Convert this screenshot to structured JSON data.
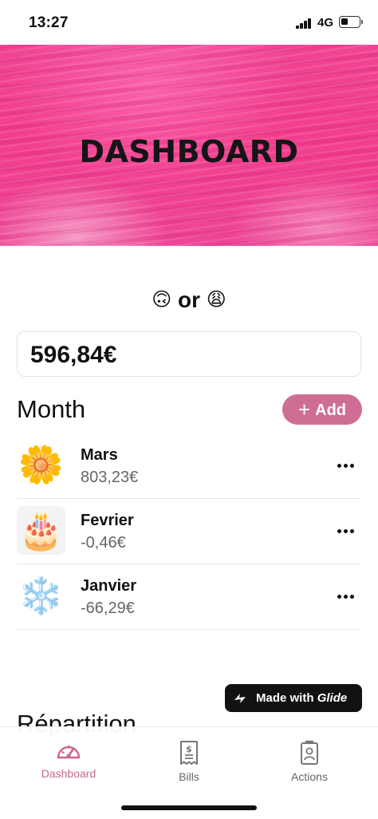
{
  "status_bar": {
    "time": "13:27",
    "network": "4G",
    "battery_level": 0.4
  },
  "hero": {
    "title": "DASHBOARD"
  },
  "mood": {
    "left_emoji": "🙃",
    "connector": "or",
    "right_emoji": "😩"
  },
  "balance": {
    "value": "596,84€"
  },
  "month_section": {
    "title": "Month",
    "add_label": "Add",
    "items": [
      {
        "icon": "🌼",
        "title": "Mars",
        "amount": "803,23€"
      },
      {
        "icon": "🎂",
        "title": "Fevrier",
        "amount": "-0,46€"
      },
      {
        "icon": "❄️",
        "title": "Janvier",
        "amount": "-66,29€"
      }
    ]
  },
  "glide_badge": {
    "prefix": "Made with",
    "brand": "Glide"
  },
  "partial_heading": "Répartition",
  "tabbar": {
    "tabs": [
      {
        "label": "Dashboard",
        "icon": "gauge-icon",
        "active": true
      },
      {
        "label": "Bills",
        "icon": "bill-icon",
        "active": false
      },
      {
        "label": "Actions",
        "icon": "contact-card-icon",
        "active": false
      }
    ]
  },
  "colors": {
    "accent": "#cf6e95",
    "hero_pink": "#f23e8d",
    "tab_active": "#c9698f"
  }
}
